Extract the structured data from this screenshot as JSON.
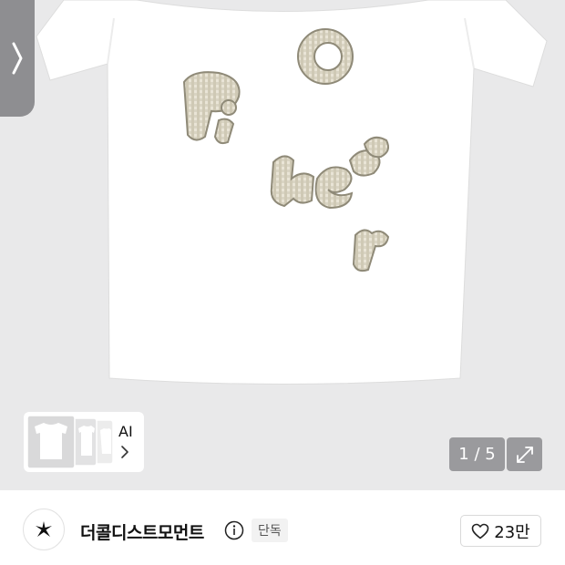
{
  "product": {
    "image_alt": "white t-shirt with gingham letter patches",
    "patch_text": "Pi neer @",
    "image_counter": "1 / 5"
  },
  "ai_card": {
    "label": "AI"
  },
  "brand": {
    "name": "더콜디스트모먼트",
    "badge": "단독"
  },
  "like": {
    "count": "23만"
  },
  "icons": {
    "side_tab": "chevron-right-icon",
    "expand": "expand-arrows-icon",
    "info": "info-icon",
    "heart": "heart-icon",
    "logo": "star-logo-icon"
  },
  "colors": {
    "overlay_gray": "#9a9a9d",
    "tab_gray": "#8e8e91",
    "background": "#e9e9ea"
  }
}
